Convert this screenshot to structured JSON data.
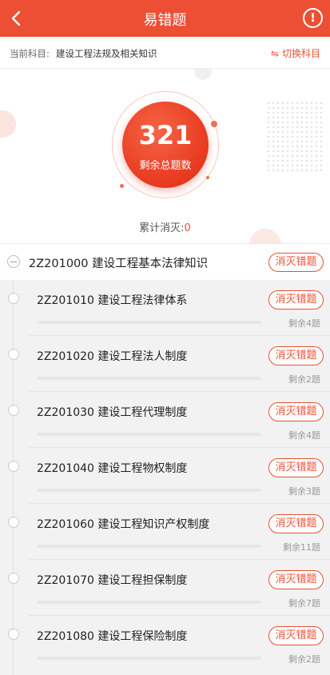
{
  "header": {
    "title": "易错题",
    "info_label": "!"
  },
  "subject": {
    "label": "当前科目:",
    "name": "建设工程法规及相关知识",
    "switch_label": "切换科目"
  },
  "stats": {
    "remaining_count": "321",
    "remaining_label": "剩余总题数",
    "cleared_label": "累计消灭:",
    "cleared_value": "0"
  },
  "section": {
    "title": "2Z201000 建设工程基本法律知识",
    "button": "消灭错题"
  },
  "items": [
    {
      "title": "2Z201010 建设工程法律体系",
      "button": "消灭错题",
      "remain": "剩余4题"
    },
    {
      "title": "2Z201020 建设工程法人制度",
      "button": "消灭错题",
      "remain": "剩余2题"
    },
    {
      "title": "2Z201030 建设工程代理制度",
      "button": "消灭错题",
      "remain": "剩余4题"
    },
    {
      "title": "2Z201040 建设工程物权制度",
      "button": "消灭错题",
      "remain": "剩余3题"
    },
    {
      "title": "2Z201060 建设工程知识产权制度",
      "button": "消灭错题",
      "remain": "剩余11题"
    },
    {
      "title": "2Z201070 建设工程担保制度",
      "button": "消灭错题",
      "remain": "剩余7题"
    },
    {
      "title": "2Z201080 建设工程保险制度",
      "button": "消灭错题",
      "remain": "剩余2题"
    }
  ],
  "colors": {
    "accent": "#ec4f33"
  }
}
